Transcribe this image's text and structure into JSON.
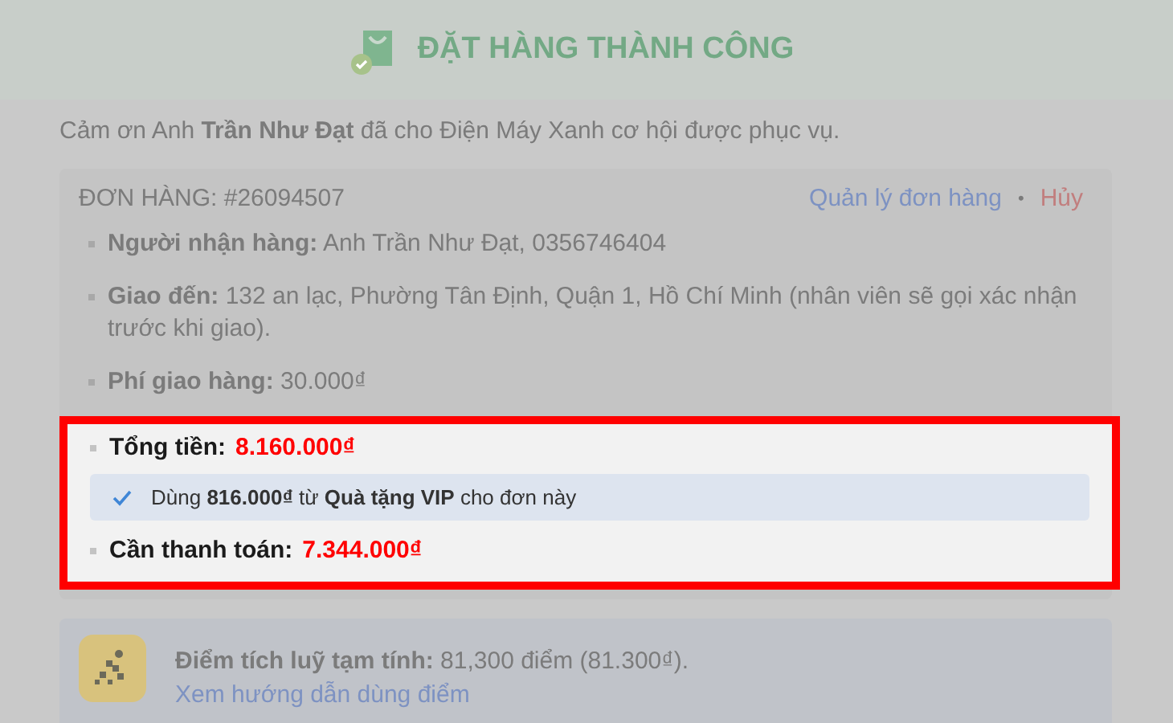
{
  "header": {
    "title": "ĐẶT HÀNG THÀNH CÔNG"
  },
  "thanks": "Cảm ơn Anh **Trần Như Đạt** đã cho Điện Máy Xanh cơ hội được phục vụ.",
  "order": {
    "number": "ĐƠN HÀNG: #26094507",
    "manage_link": "Quản lý đơn hàng",
    "separator": "•",
    "cancel_link": "Hủy",
    "items": [
      {
        "text": "**Người nhận hàng:** Anh Trần Như Đạt, 0356746404"
      },
      {
        "text": "**Giao đến:** 132 an lạc, Phường Tân Định, Quận 1, Hồ Chí Minh (nhân viên sẽ gọi xác nhận trước khi giao)."
      },
      {
        "text": "**Phí giao hàng:** 30.000₫"
      }
    ]
  },
  "highlight": {
    "total": {
      "label": "Tổng tiền:",
      "amount": "8.160.000₫"
    },
    "vip_note": {
      "checked": true,
      "text": "Dùng **816.000₫** từ **Quà tặng VIP** cho đơn này"
    },
    "payable": {
      "label": "Cần thanh toán:",
      "amount": "7.344.000₫"
    }
  },
  "points": {
    "text": "**Điểm tích luỹ tạm tính:** 81,300 điểm (81.300₫).",
    "link": "Xem hướng dẫn dùng điểm"
  }
}
